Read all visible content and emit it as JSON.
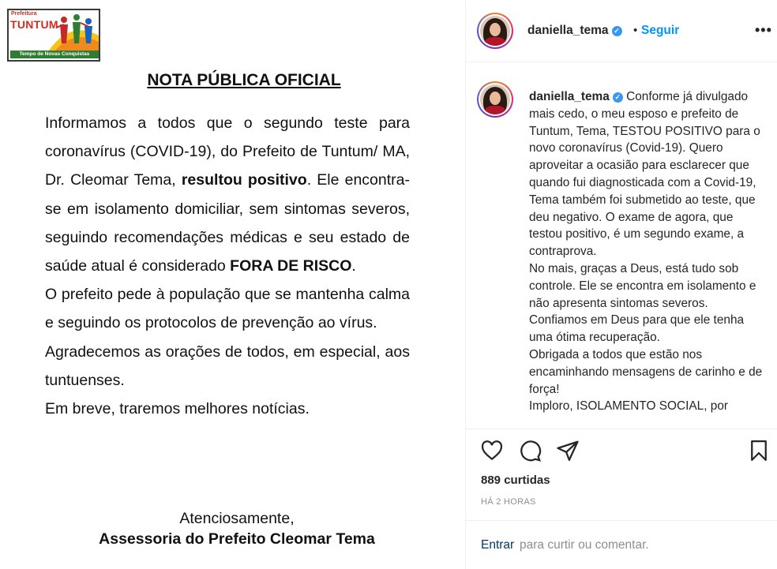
{
  "note": {
    "logo": {
      "top_text": "Prefeitura",
      "name": "TUNTUM",
      "tagline": "Tempo de Novas Conquistas"
    },
    "title": "NOTA PÚBLICA OFICIAL",
    "p1_a": "Informamos a todos que o segundo teste para coronavírus (COVID-19), do Prefeito de Tuntum/ MA, Dr. Cleomar Tema, ",
    "p1_bold": "resultou positivo",
    "p1_b": ". Ele encontra-se em isolamento domiciliar, sem sintomas severos, seguindo recomendações médicas e seu estado de saúde atual é considerado ",
    "p1_bold2": "FORA DE RISCO",
    "p1_c": ".",
    "p2": "O prefeito pede à população que se mantenha calma e seguindo os protocolos de prevenção ao vírus.",
    "p3": "Agradecemos as orações de todos, em especial, aos tuntuenses.",
    "p4": "Em breve, traremos melhores notícias.",
    "closing": "Atenciosamente,",
    "signature": "Assessoria do Prefeito Cleomar Tema"
  },
  "header": {
    "username": "daniella_tema",
    "separator": "•",
    "follow_label": "Seguir",
    "more_label": "•••"
  },
  "caption": {
    "username": "daniella_tema",
    "text": "Conforme já divulgado mais cedo, o meu esposo e prefeito de Tuntum, Tema, TESTOU POSITIVO para o novo coronavírus (Covid-19). Quero aproveitar a ocasião para esclarecer que quando fui diagnosticada com a Covid-19, Tema também foi submetido ao teste, que deu negativo. O exame de agora, que testou positivo, é um segundo exame, a contraprova.\nNo mais, graças a Deus, está tudo sob controle. Ele se encontra em isolamento e não apresenta sintomas severos. Confiamos em Deus para que ele tenha uma ótima recuperação.\nObrigada a todos que estão nos encaminhando mensagens de carinho e de força!\nImploro, ISOLAMENTO SOCIAL, por"
  },
  "actions": {
    "icons": [
      "heart-icon",
      "comment-icon",
      "share-icon",
      "bookmark-icon"
    ],
    "likes": "889 curtidas",
    "time": "HÁ 2 HORAS"
  },
  "comment": {
    "login_link": "Entrar",
    "rest": " para curtir ou comentar."
  },
  "colors": {
    "link_blue": "#0095f6",
    "verified_blue": "#3897f0",
    "border": "#efefef",
    "muted": "#8e8e8e"
  }
}
